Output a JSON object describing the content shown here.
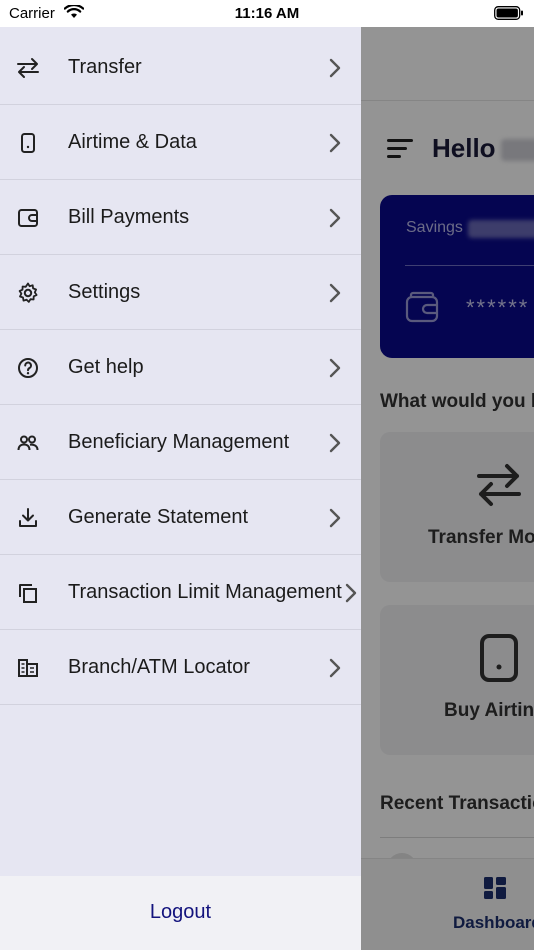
{
  "status_bar": {
    "carrier": "Carrier",
    "time": "11:16 AM"
  },
  "drawer": {
    "items": [
      {
        "label": "Transfer",
        "icon": "transfer-arrows-icon"
      },
      {
        "label": "Airtime & Data",
        "icon": "phone-icon"
      },
      {
        "label": "Bill Payments",
        "icon": "wallet-icon"
      },
      {
        "label": "Settings",
        "icon": "gear-icon"
      },
      {
        "label": "Get help",
        "icon": "help-circle-icon"
      },
      {
        "label": "Beneficiary Management",
        "icon": "people-icon"
      },
      {
        "label": "Generate Statement",
        "icon": "download-icon"
      },
      {
        "label": "Transaction Limit Management",
        "icon": "copy-icon"
      },
      {
        "label": "Branch/ATM Locator",
        "icon": "building-icon"
      }
    ],
    "logout_label": "Logout"
  },
  "background_screen": {
    "greeting": "Hello",
    "account_card": {
      "account_type": "Savings",
      "masked_balance": "******"
    },
    "quick_actions_heading": "What would you l",
    "quick_actions": [
      {
        "label": "Transfer Mo",
        "icon": "transfer-arrows-icon"
      },
      {
        "label": "Buy Airtin",
        "icon": "phone-icon"
      }
    ],
    "recent_heading": "Recent Transactio",
    "tab_bar": {
      "active_tab": "Dashboard",
      "active_icon": "dashboard-grid-icon"
    }
  },
  "colors": {
    "drawer_bg": "#e6e6f2",
    "card_bg": "#0a0a8c",
    "logout_text": "#13137d",
    "overlay": "rgba(0,0,0,0.42)"
  }
}
